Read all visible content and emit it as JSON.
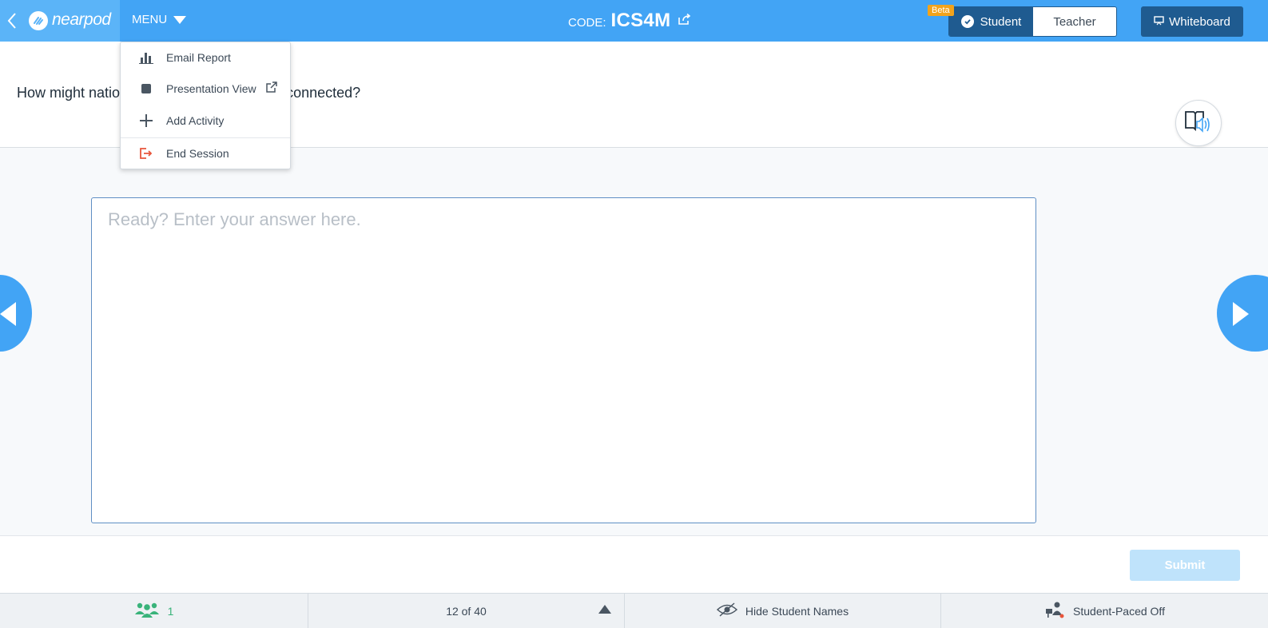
{
  "topbar": {
    "brand": "nearpod",
    "menu_label": "MENU",
    "code_label": "CODE:",
    "code_value": "ICS4M",
    "beta_badge": "Beta",
    "student_label": "Student",
    "teacher_label": "Teacher",
    "whiteboard_label": "Whiteboard"
  },
  "menu": {
    "items": [
      {
        "label": "Email Report",
        "icon": "bar-chart-icon"
      },
      {
        "label": "Presentation View",
        "icon": "square-icon"
      },
      {
        "label": "Add Activity",
        "icon": "plus-icon"
      },
      {
        "label": "End Session",
        "icon": "exit-icon"
      }
    ]
  },
  "question": {
    "text_before": "How might natio",
    "text_after": "connected?"
  },
  "answer": {
    "placeholder": "Ready? Enter your answer here.",
    "value": ""
  },
  "submit_label": "Submit",
  "statusbar": {
    "student_count": "1",
    "page_indicator": "12 of 40",
    "hide_names_label": "Hide Student Names",
    "student_paced_label": "Student-Paced Off"
  },
  "colors": {
    "topbar": "#42a4f5",
    "brand_bg": "#5bb4f8",
    "dark_blue": "#1f5b90",
    "beta": "#f2a31b",
    "end_session": "#e8553b",
    "students_green": "#39b37a",
    "submit_disabled": "#bfe3fb"
  }
}
